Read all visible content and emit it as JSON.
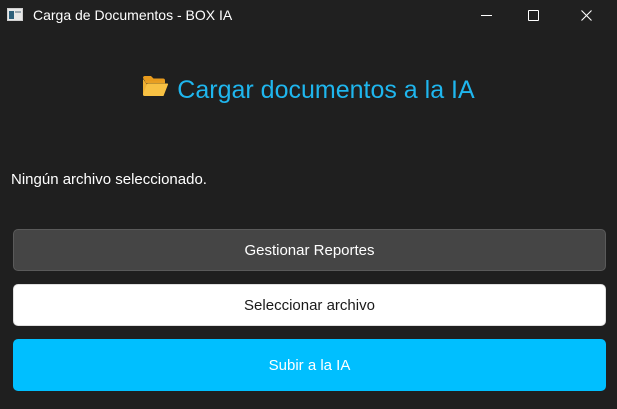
{
  "window": {
    "title": "Carga de Documentos - BOX IA",
    "minimize_icon": "minimize-icon",
    "maximize_icon": "maximize-icon",
    "close_icon": "close-icon"
  },
  "main": {
    "heading": "Cargar documentos a la IA",
    "heading_icon": "open-folder-icon",
    "status_text": "Ningún archivo seleccionado."
  },
  "actions": {
    "manage_reports_label": "Gestionar Reportes",
    "select_file_label": "Seleccionar archivo",
    "upload_label": "Subir a la IA"
  },
  "colors": {
    "background": "#1f1f1f",
    "heading": "#1fb6ee",
    "manage_reports_button": "#454545",
    "select_file_button": "#ffffff",
    "upload_button": "#00bfff"
  }
}
